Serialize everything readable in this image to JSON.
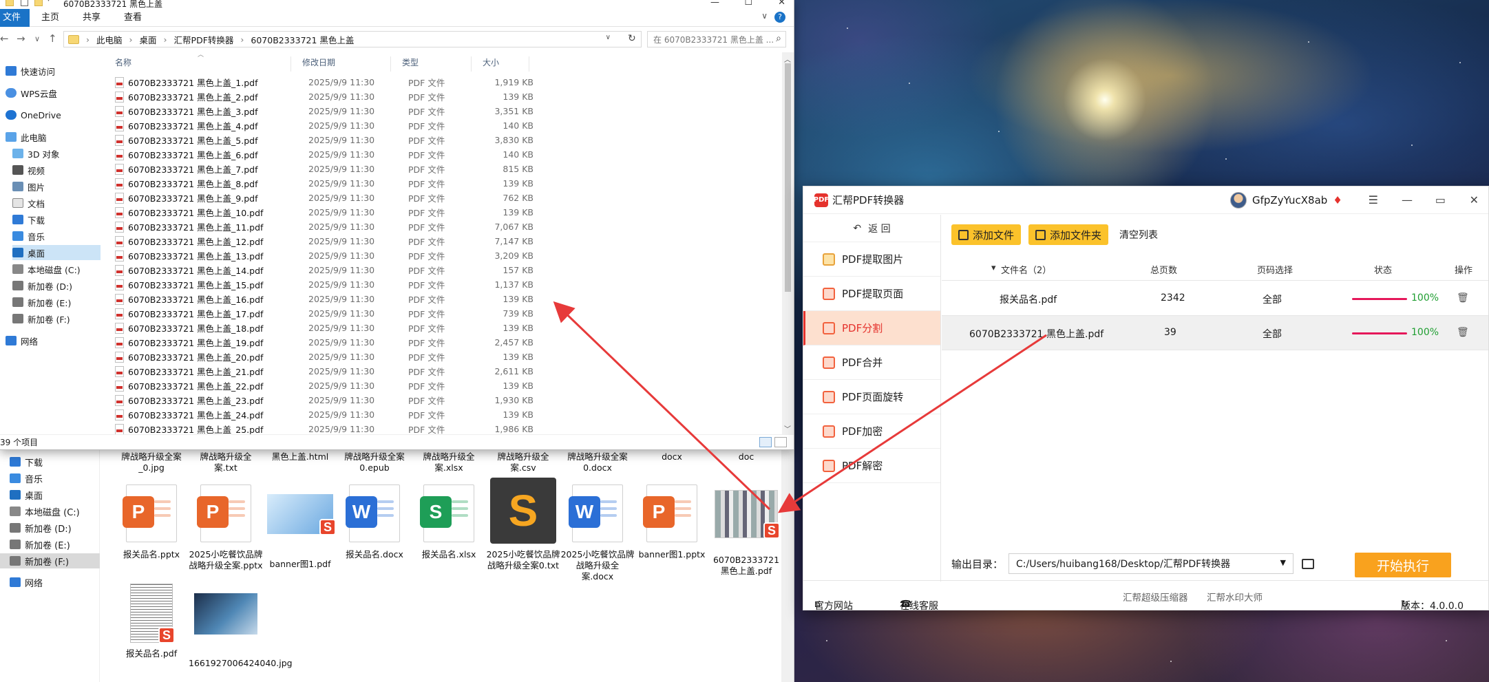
{
  "explorer": {
    "title": "6070B2333721 黑色上盖",
    "ribbon": {
      "file": "文件",
      "home": "主页",
      "share": "共享",
      "view": "查看",
      "help": "?"
    },
    "breadcrumb": [
      "此电脑",
      "桌面",
      "汇帮PDF转换器",
      "6070B2333721 黑色上盖"
    ],
    "search_placeholder": "在 6070B2333721 黑色上盖 ...",
    "sidebar": {
      "quick_access": "快速访问",
      "wps": "WPS云盘",
      "onedrive": "OneDrive",
      "this_pc": "此电脑",
      "objects3d": "3D 对象",
      "video": "视频",
      "pictures": "图片",
      "docs": "文档",
      "downloads": "下载",
      "music": "音乐",
      "desktop": "桌面",
      "local_c": "本地磁盘 (C:)",
      "vol_d": "新加卷 (D:)",
      "vol_e": "新加卷 (E:)",
      "vol_f": "新加卷 (F:)",
      "network": "网络"
    },
    "columns": {
      "name": "名称",
      "date": "修改日期",
      "type": "类型",
      "size": "大小"
    },
    "files": [
      {
        "name": "6070B2333721 黑色上盖_1.pdf",
        "date": "2025/9/9 11:30",
        "type": "PDF 文件",
        "size": "1,919 KB"
      },
      {
        "name": "6070B2333721 黑色上盖_2.pdf",
        "date": "2025/9/9 11:30",
        "type": "PDF 文件",
        "size": "139 KB"
      },
      {
        "name": "6070B2333721 黑色上盖_3.pdf",
        "date": "2025/9/9 11:30",
        "type": "PDF 文件",
        "size": "3,351 KB"
      },
      {
        "name": "6070B2333721 黑色上盖_4.pdf",
        "date": "2025/9/9 11:30",
        "type": "PDF 文件",
        "size": "140 KB"
      },
      {
        "name": "6070B2333721 黑色上盖_5.pdf",
        "date": "2025/9/9 11:30",
        "type": "PDF 文件",
        "size": "3,830 KB"
      },
      {
        "name": "6070B2333721 黑色上盖_6.pdf",
        "date": "2025/9/9 11:30",
        "type": "PDF 文件",
        "size": "140 KB"
      },
      {
        "name": "6070B2333721 黑色上盖_7.pdf",
        "date": "2025/9/9 11:30",
        "type": "PDF 文件",
        "size": "815 KB"
      },
      {
        "name": "6070B2333721 黑色上盖_8.pdf",
        "date": "2025/9/9 11:30",
        "type": "PDF 文件",
        "size": "139 KB"
      },
      {
        "name": "6070B2333721 黑色上盖_9.pdf",
        "date": "2025/9/9 11:30",
        "type": "PDF 文件",
        "size": "762 KB"
      },
      {
        "name": "6070B2333721 黑色上盖_10.pdf",
        "date": "2025/9/9 11:30",
        "type": "PDF 文件",
        "size": "139 KB"
      },
      {
        "name": "6070B2333721 黑色上盖_11.pdf",
        "date": "2025/9/9 11:30",
        "type": "PDF 文件",
        "size": "7,067 KB"
      },
      {
        "name": "6070B2333721 黑色上盖_12.pdf",
        "date": "2025/9/9 11:30",
        "type": "PDF 文件",
        "size": "7,147 KB"
      },
      {
        "name": "6070B2333721 黑色上盖_13.pdf",
        "date": "2025/9/9 11:30",
        "type": "PDF 文件",
        "size": "3,209 KB"
      },
      {
        "name": "6070B2333721 黑色上盖_14.pdf",
        "date": "2025/9/9 11:30",
        "type": "PDF 文件",
        "size": "157 KB"
      },
      {
        "name": "6070B2333721 黑色上盖_15.pdf",
        "date": "2025/9/9 11:30",
        "type": "PDF 文件",
        "size": "1,137 KB"
      },
      {
        "name": "6070B2333721 黑色上盖_16.pdf",
        "date": "2025/9/9 11:30",
        "type": "PDF 文件",
        "size": "139 KB"
      },
      {
        "name": "6070B2333721 黑色上盖_17.pdf",
        "date": "2025/9/9 11:30",
        "type": "PDF 文件",
        "size": "739 KB"
      },
      {
        "name": "6070B2333721 黑色上盖_18.pdf",
        "date": "2025/9/9 11:30",
        "type": "PDF 文件",
        "size": "139 KB"
      },
      {
        "name": "6070B2333721 黑色上盖_19.pdf",
        "date": "2025/9/9 11:30",
        "type": "PDF 文件",
        "size": "2,457 KB"
      },
      {
        "name": "6070B2333721 黑色上盖_20.pdf",
        "date": "2025/9/9 11:30",
        "type": "PDF 文件",
        "size": "139 KB"
      },
      {
        "name": "6070B2333721 黑色上盖_21.pdf",
        "date": "2025/9/9 11:30",
        "type": "PDF 文件",
        "size": "2,611 KB"
      },
      {
        "name": "6070B2333721 黑色上盖_22.pdf",
        "date": "2025/9/9 11:30",
        "type": "PDF 文件",
        "size": "139 KB"
      },
      {
        "name": "6070B2333721 黑色上盖_23.pdf",
        "date": "2025/9/9 11:30",
        "type": "PDF 文件",
        "size": "1,930 KB"
      },
      {
        "name": "6070B2333721 黑色上盖_24.pdf",
        "date": "2025/9/9 11:30",
        "type": "PDF 文件",
        "size": "139 KB"
      },
      {
        "name": "6070B2333721 黑色上盖_25.pdf",
        "date": "2025/9/9 11:30",
        "type": "PDF 文件",
        "size": "1,986 KB"
      }
    ],
    "status": "39 个项目"
  },
  "explorer_back": {
    "sidebar": {
      "downloads": "下载",
      "music": "音乐",
      "desktop": "桌面",
      "local_c": "本地磁盘 (C:)",
      "vol_d": "新加卷 (D:)",
      "vol_e": "新加卷 (E:)",
      "vol_f": "新加卷 (F:)",
      "network": "网络"
    },
    "top_labels": [
      "牌战略升级全案_0.jpg",
      "牌战略升级全案.txt",
      "黑色上盖.html",
      "牌战略升级全案0.epub",
      "牌战略升级全案.xlsx",
      "牌战略升级全案.csv",
      "牌战略升级全案0.docx",
      "docx",
      "doc"
    ],
    "tiles": [
      {
        "label": "报关品名.pptx",
        "kind": "ppt"
      },
      {
        "label": "2025小吃餐饮品牌战略升级全案.pptx",
        "kind": "ppt"
      },
      {
        "label": "banner图1.pdf",
        "kind": "img-pdf"
      },
      {
        "label": "报关品名.docx",
        "kind": "word"
      },
      {
        "label": "报关品名.xlsx",
        "kind": "excel"
      },
      {
        "label": "2025小吃餐饮品牌战略升级全案0.txt",
        "kind": "sublime"
      },
      {
        "label": "2025小吃餐饮品牌战略升级全案.docx",
        "kind": "word"
      },
      {
        "label": "banner图1.pptx",
        "kind": "ppt"
      },
      {
        "label": "6070B2333721 黑色上盖.pdf",
        "kind": "thumb-pdf"
      },
      {
        "label": "报关品名.pdf",
        "kind": "list-pdf"
      },
      {
        "label": "1661927006424040.jpg",
        "kind": "photo"
      }
    ]
  },
  "app": {
    "title": "汇帮PDF转换器",
    "logo_text": "PDF",
    "username": "GfpZyYucX8ab",
    "back": "返 回",
    "menu": [
      "PDF提取图片",
      "PDF提取页面",
      "PDF分割",
      "PDF合并",
      "PDF页面旋转",
      "PDF加密",
      "PDF解密"
    ],
    "active_menu": "PDF分割",
    "toolbar": {
      "add_file": "添加文件",
      "add_folder": "添加文件夹",
      "clear": "清空列表"
    },
    "table_headers": {
      "filename": "文件名（2）",
      "pages": "总页数",
      "page_select": "页码选择",
      "status": "状态",
      "action": "操作"
    },
    "rows": [
      {
        "name": "报关品名.pdf",
        "pages": "2342",
        "select": "全部",
        "progress": "100%"
      },
      {
        "name": "6070B2333721 黑色上盖.pdf",
        "pages": "39",
        "select": "全部",
        "progress": "100%"
      }
    ],
    "output_label": "输出目录：",
    "output_path": "C:/Users/huibang168/Desktop/汇帮PDF转换器",
    "start": "开始执行",
    "footer": {
      "website": "官方网站",
      "service": "在线客服",
      "compress": "汇帮超级压缩器",
      "watermark": "汇帮水印大师",
      "version": "版本：4.0.0.0"
    },
    "colors": {
      "accent": "#e5322d",
      "button": "#fbc22b",
      "start": "#f9a21e",
      "progress": "#e5175a",
      "percent": "#1f9e31"
    }
  }
}
